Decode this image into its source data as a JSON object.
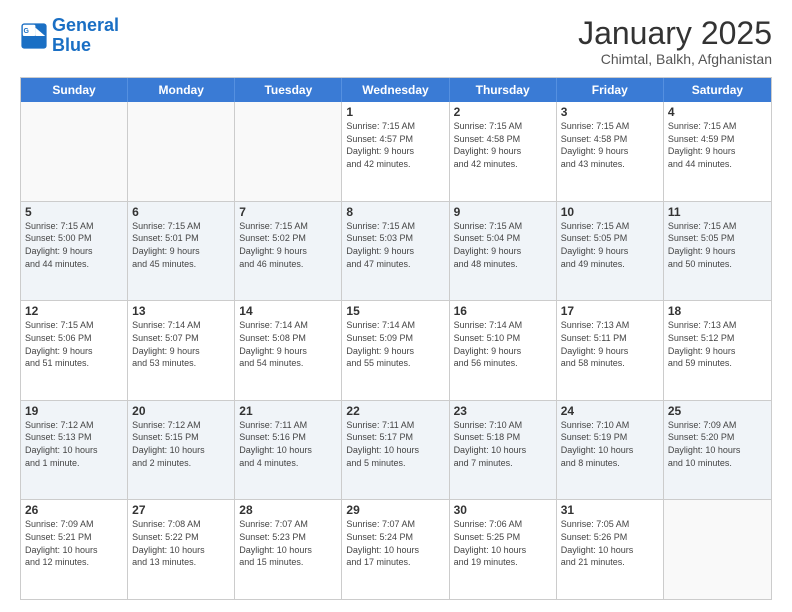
{
  "logo": {
    "line1": "General",
    "line2": "Blue"
  },
  "title": "January 2025",
  "location": "Chimtal, Balkh, Afghanistan",
  "dayHeaders": [
    "Sunday",
    "Monday",
    "Tuesday",
    "Wednesday",
    "Thursday",
    "Friday",
    "Saturday"
  ],
  "rows": [
    {
      "shaded": false,
      "cells": [
        {
          "empty": true,
          "number": "",
          "info": ""
        },
        {
          "empty": true,
          "number": "",
          "info": ""
        },
        {
          "empty": true,
          "number": "",
          "info": ""
        },
        {
          "empty": false,
          "number": "1",
          "info": "Sunrise: 7:15 AM\nSunset: 4:57 PM\nDaylight: 9 hours\nand 42 minutes."
        },
        {
          "empty": false,
          "number": "2",
          "info": "Sunrise: 7:15 AM\nSunset: 4:58 PM\nDaylight: 9 hours\nand 42 minutes."
        },
        {
          "empty": false,
          "number": "3",
          "info": "Sunrise: 7:15 AM\nSunset: 4:58 PM\nDaylight: 9 hours\nand 43 minutes."
        },
        {
          "empty": false,
          "number": "4",
          "info": "Sunrise: 7:15 AM\nSunset: 4:59 PM\nDaylight: 9 hours\nand 44 minutes."
        }
      ]
    },
    {
      "shaded": true,
      "cells": [
        {
          "empty": false,
          "number": "5",
          "info": "Sunrise: 7:15 AM\nSunset: 5:00 PM\nDaylight: 9 hours\nand 44 minutes."
        },
        {
          "empty": false,
          "number": "6",
          "info": "Sunrise: 7:15 AM\nSunset: 5:01 PM\nDaylight: 9 hours\nand 45 minutes."
        },
        {
          "empty": false,
          "number": "7",
          "info": "Sunrise: 7:15 AM\nSunset: 5:02 PM\nDaylight: 9 hours\nand 46 minutes."
        },
        {
          "empty": false,
          "number": "8",
          "info": "Sunrise: 7:15 AM\nSunset: 5:03 PM\nDaylight: 9 hours\nand 47 minutes."
        },
        {
          "empty": false,
          "number": "9",
          "info": "Sunrise: 7:15 AM\nSunset: 5:04 PM\nDaylight: 9 hours\nand 48 minutes."
        },
        {
          "empty": false,
          "number": "10",
          "info": "Sunrise: 7:15 AM\nSunset: 5:05 PM\nDaylight: 9 hours\nand 49 minutes."
        },
        {
          "empty": false,
          "number": "11",
          "info": "Sunrise: 7:15 AM\nSunset: 5:05 PM\nDaylight: 9 hours\nand 50 minutes."
        }
      ]
    },
    {
      "shaded": false,
      "cells": [
        {
          "empty": false,
          "number": "12",
          "info": "Sunrise: 7:15 AM\nSunset: 5:06 PM\nDaylight: 9 hours\nand 51 minutes."
        },
        {
          "empty": false,
          "number": "13",
          "info": "Sunrise: 7:14 AM\nSunset: 5:07 PM\nDaylight: 9 hours\nand 53 minutes."
        },
        {
          "empty": false,
          "number": "14",
          "info": "Sunrise: 7:14 AM\nSunset: 5:08 PM\nDaylight: 9 hours\nand 54 minutes."
        },
        {
          "empty": false,
          "number": "15",
          "info": "Sunrise: 7:14 AM\nSunset: 5:09 PM\nDaylight: 9 hours\nand 55 minutes."
        },
        {
          "empty": false,
          "number": "16",
          "info": "Sunrise: 7:14 AM\nSunset: 5:10 PM\nDaylight: 9 hours\nand 56 minutes."
        },
        {
          "empty": false,
          "number": "17",
          "info": "Sunrise: 7:13 AM\nSunset: 5:11 PM\nDaylight: 9 hours\nand 58 minutes."
        },
        {
          "empty": false,
          "number": "18",
          "info": "Sunrise: 7:13 AM\nSunset: 5:12 PM\nDaylight: 9 hours\nand 59 minutes."
        }
      ]
    },
    {
      "shaded": true,
      "cells": [
        {
          "empty": false,
          "number": "19",
          "info": "Sunrise: 7:12 AM\nSunset: 5:13 PM\nDaylight: 10 hours\nand 1 minute."
        },
        {
          "empty": false,
          "number": "20",
          "info": "Sunrise: 7:12 AM\nSunset: 5:15 PM\nDaylight: 10 hours\nand 2 minutes."
        },
        {
          "empty": false,
          "number": "21",
          "info": "Sunrise: 7:11 AM\nSunset: 5:16 PM\nDaylight: 10 hours\nand 4 minutes."
        },
        {
          "empty": false,
          "number": "22",
          "info": "Sunrise: 7:11 AM\nSunset: 5:17 PM\nDaylight: 10 hours\nand 5 minutes."
        },
        {
          "empty": false,
          "number": "23",
          "info": "Sunrise: 7:10 AM\nSunset: 5:18 PM\nDaylight: 10 hours\nand 7 minutes."
        },
        {
          "empty": false,
          "number": "24",
          "info": "Sunrise: 7:10 AM\nSunset: 5:19 PM\nDaylight: 10 hours\nand 8 minutes."
        },
        {
          "empty": false,
          "number": "25",
          "info": "Sunrise: 7:09 AM\nSunset: 5:20 PM\nDaylight: 10 hours\nand 10 minutes."
        }
      ]
    },
    {
      "shaded": false,
      "cells": [
        {
          "empty": false,
          "number": "26",
          "info": "Sunrise: 7:09 AM\nSunset: 5:21 PM\nDaylight: 10 hours\nand 12 minutes."
        },
        {
          "empty": false,
          "number": "27",
          "info": "Sunrise: 7:08 AM\nSunset: 5:22 PM\nDaylight: 10 hours\nand 13 minutes."
        },
        {
          "empty": false,
          "number": "28",
          "info": "Sunrise: 7:07 AM\nSunset: 5:23 PM\nDaylight: 10 hours\nand 15 minutes."
        },
        {
          "empty": false,
          "number": "29",
          "info": "Sunrise: 7:07 AM\nSunset: 5:24 PM\nDaylight: 10 hours\nand 17 minutes."
        },
        {
          "empty": false,
          "number": "30",
          "info": "Sunrise: 7:06 AM\nSunset: 5:25 PM\nDaylight: 10 hours\nand 19 minutes."
        },
        {
          "empty": false,
          "number": "31",
          "info": "Sunrise: 7:05 AM\nSunset: 5:26 PM\nDaylight: 10 hours\nand 21 minutes."
        },
        {
          "empty": true,
          "number": "",
          "info": ""
        }
      ]
    }
  ]
}
